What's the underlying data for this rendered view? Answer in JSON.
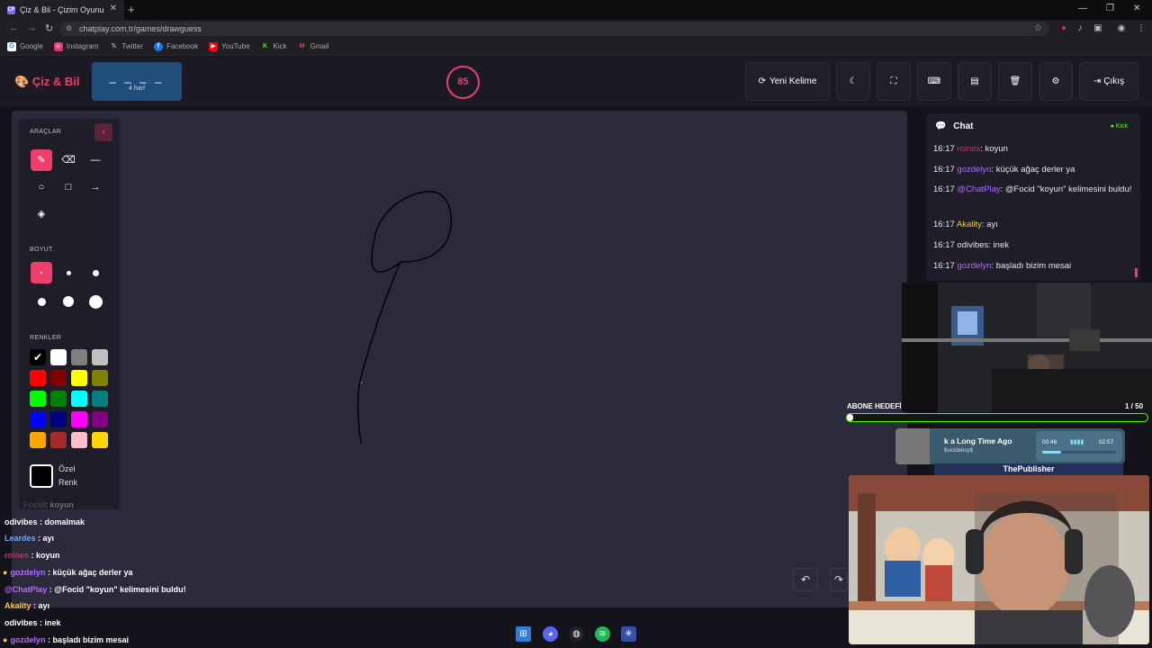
{
  "browser": {
    "tab_title": "Çiz & Bil - Çizim Oyunu",
    "tab_favicon": "CP",
    "url": "chatplay.com.tr/games/drawguess",
    "bookmarks": [
      {
        "label": "Google",
        "icon": "google-icon",
        "color": "#ffffff"
      },
      {
        "label": "Instagram",
        "icon": "instagram-icon",
        "color": "#e1306c"
      },
      {
        "label": "Twitter",
        "icon": "x-icon",
        "color": "#000000"
      },
      {
        "label": "Facebook",
        "icon": "facebook-icon",
        "color": "#1877f2"
      },
      {
        "label": "YouTube",
        "icon": "youtube-icon",
        "color": "#ff0000"
      },
      {
        "label": "Kick",
        "icon": "kick-icon",
        "color": "#53fc18"
      },
      {
        "label": "Gmail",
        "icon": "gmail-icon",
        "color": "#ea4335"
      }
    ]
  },
  "header": {
    "logo": "Çiz & Bil",
    "word_mask": "_ _ _ _",
    "word_hint": "4 harf",
    "timer": "85",
    "new_word": "Yeni Kelime",
    "exit": "Çıkış"
  },
  "tools": {
    "title": "ARAÇLAR",
    "size_title": "BOYUT",
    "colors_title": "RENKLER",
    "custom_line1": "Özel",
    "custom_line2": "Renk",
    "colors": [
      "#000000",
      "#ffffff",
      "#808080",
      "#c0c0c0",
      "#ff0000",
      "#800000",
      "#ffff00",
      "#808000",
      "#00ff00",
      "#008000",
      "#00ffff",
      "#008080",
      "#0000ff",
      "#000080",
      "#ff00ff",
      "#800080",
      "#ffa500",
      "#a52a2a",
      "#ffc0cb",
      "#ffd700"
    ]
  },
  "chat": {
    "title": "Chat",
    "platform": "Kick",
    "messages": [
      {
        "time": "16:17",
        "user": "roines",
        "color": "#e0245e",
        "text": ": koyun"
      },
      {
        "time": "16:17",
        "user": "gozdelyn",
        "color": "#b36bff",
        "text": ": küçük ağaç derler ya"
      },
      {
        "time": "16:17",
        "user": "@ChatPlay",
        "color": "#b36bff",
        "text": ": @Focid \"koyun\" kelimesini buldu!"
      },
      {
        "time": "16:17",
        "user": "Akality",
        "color": "#f2c94c",
        "text": ": ayı"
      },
      {
        "time": "16:17",
        "user": "odivibes",
        "color": "#e7e7ee",
        "text": ": inek"
      },
      {
        "time": "16:17",
        "user": "gozdelyn",
        "color": "#b36bff",
        "text": ": başladı bizim mesai"
      }
    ]
  },
  "overlay": {
    "goal_label": "ABONE HEDEFİ",
    "goal_count": "1 / 50",
    "goal_progress": 0.02,
    "song": "k a Long Time Ago",
    "artist": "$uicideboy$",
    "time_elapsed": "00:46",
    "time_total": "02:57",
    "song_progress": 0.26,
    "publisher": "ThePublisher",
    "stream_chat": [
      {
        "user": "Focid",
        "color": "#888888",
        "text": ": koyun"
      },
      {
        "user": "odivibes",
        "color": "#ffffff",
        "text": " : domalmak"
      },
      {
        "user": "Leardes",
        "color": "#6fa8ff",
        "text": " : ayı"
      },
      {
        "user": "roines",
        "color": "#e0245e",
        "text": " : koyun"
      },
      {
        "user": "gozdelyn",
        "color": "#b36bff",
        "text": " : küçük ağaç derler ya"
      },
      {
        "user": "@ChatPlay",
        "color": "#b36bff",
        "text": " : @Focid \"koyun\" kelimesini buldu!"
      },
      {
        "user": "Akality",
        "color": "#f2c94c",
        "text": " : ayı"
      },
      {
        "user": "odivibes",
        "color": "#ffffff",
        "text": " : inek"
      },
      {
        "user": "gozdelyn",
        "color": "#b36bff",
        "text": " : başladı bizim mesai"
      }
    ]
  }
}
